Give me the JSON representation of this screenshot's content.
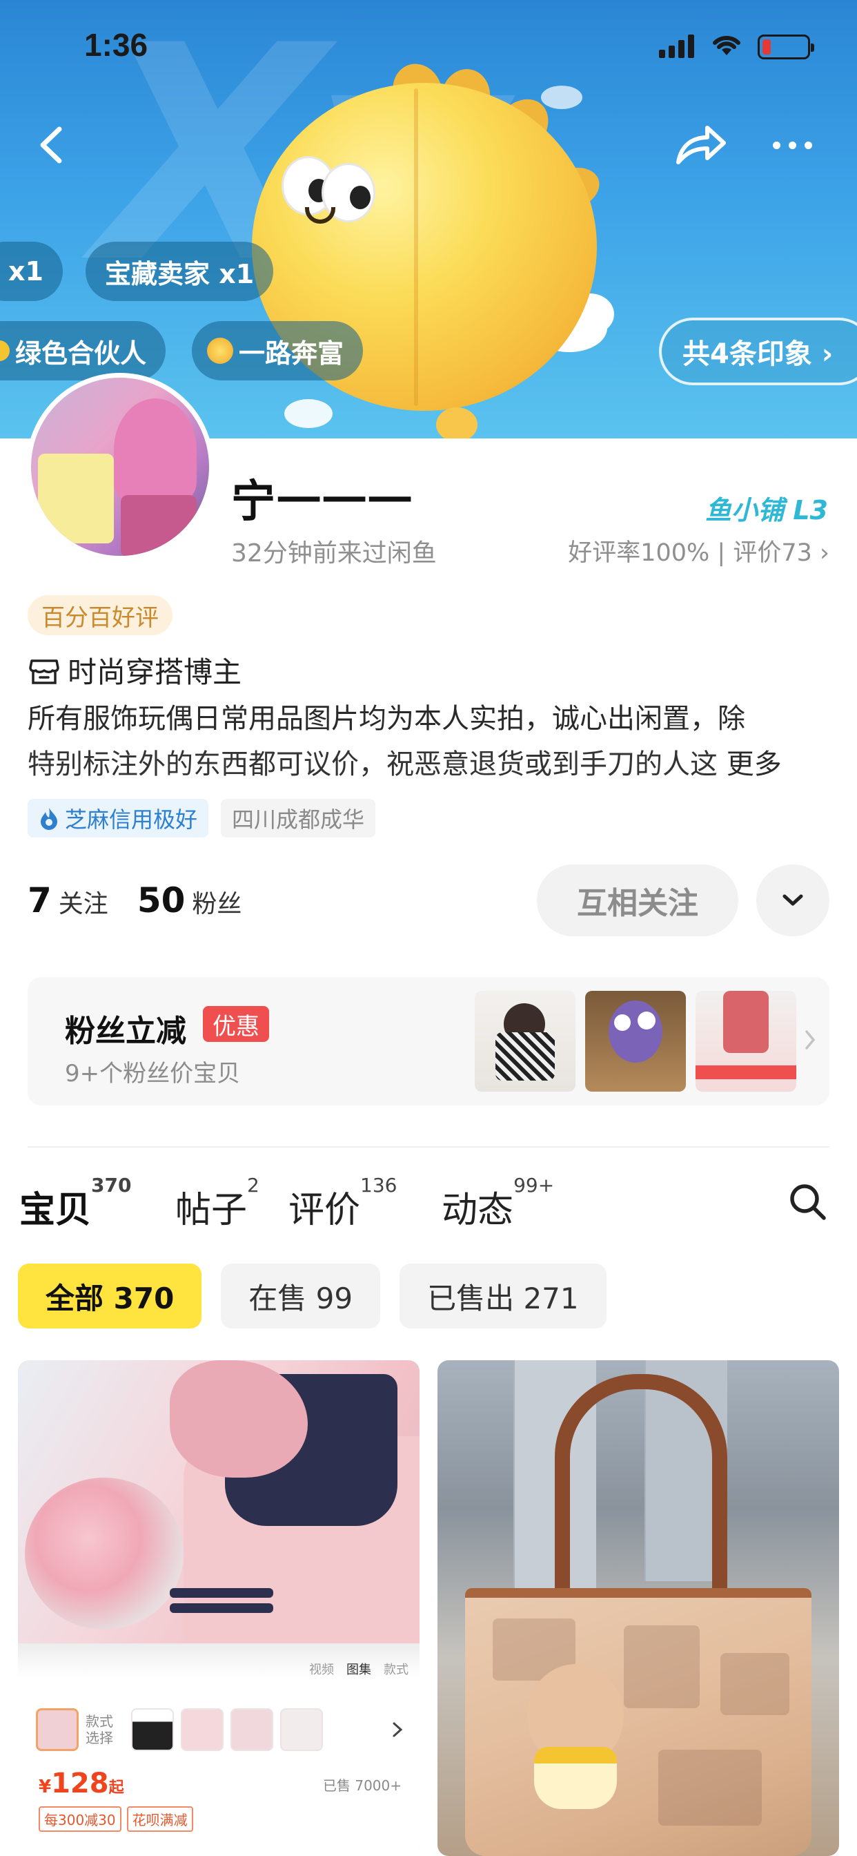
{
  "status_bar": {
    "time": "1:36"
  },
  "hero": {
    "tags": [
      {
        "label": "x1",
        "icon": "medal-icon"
      },
      {
        "label": "宝藏卖家 x1",
        "icon": ""
      },
      {
        "label": "绿色合伙人",
        "icon": "leaf-icon"
      },
      {
        "label": "一路奔富",
        "icon": "gold-ingot-icon"
      }
    ],
    "impression_button": "共4条印象 ›"
  },
  "profile": {
    "nickname": "宁一一一",
    "last_seen": "32分钟前来过闲鱼",
    "shop_level": "鱼小铺 L3",
    "rating": "好评率100% | 评价73 ›",
    "good_badge": "百分百好评",
    "role": "时尚穿搭博主",
    "bio_line1": "所有服饰玩偶日常用品图片均为本人实拍，诚心出闲置，除",
    "bio_line2": "特别标注外的东西都可议价，祝恶意退货或到手刀的人这",
    "bio_more": "更多",
    "credit_tag": "芝麻信用极好",
    "location_tag": "四川成都成华"
  },
  "stats": {
    "following_count": "7",
    "following_label": "关注",
    "fans_count": "50",
    "fans_label": "粉丝"
  },
  "actions": {
    "follow_label": "互相关注"
  },
  "fan_card": {
    "title": "粉丝立减",
    "badge": "优惠",
    "subtitle": "9+个粉丝价宝贝"
  },
  "tabs": [
    {
      "label": "宝贝",
      "count": "370"
    },
    {
      "label": "帖子",
      "count": "2"
    },
    {
      "label": "评价",
      "count": "136"
    },
    {
      "label": "动态",
      "count": "99+"
    }
  ],
  "filters": [
    {
      "label": "全部 370",
      "active": true
    },
    {
      "label": "在售 99",
      "active": false
    },
    {
      "label": "已售出 271",
      "active": false
    }
  ],
  "product_left": {
    "panel_tabs": [
      "视频",
      "图集",
      "款式"
    ],
    "variant_label": "款式选择",
    "price_currency": "¥",
    "price_value": "128",
    "price_suffix": "起",
    "sold": "已售 7000+",
    "promo1": "每300减30",
    "promo2": "花呗满减"
  },
  "colors": {
    "accent_yellow": "#ffe33f",
    "link_blue": "#2e7fd0",
    "shop_cyan": "#2fb7d6",
    "price_red": "#f0441f"
  }
}
